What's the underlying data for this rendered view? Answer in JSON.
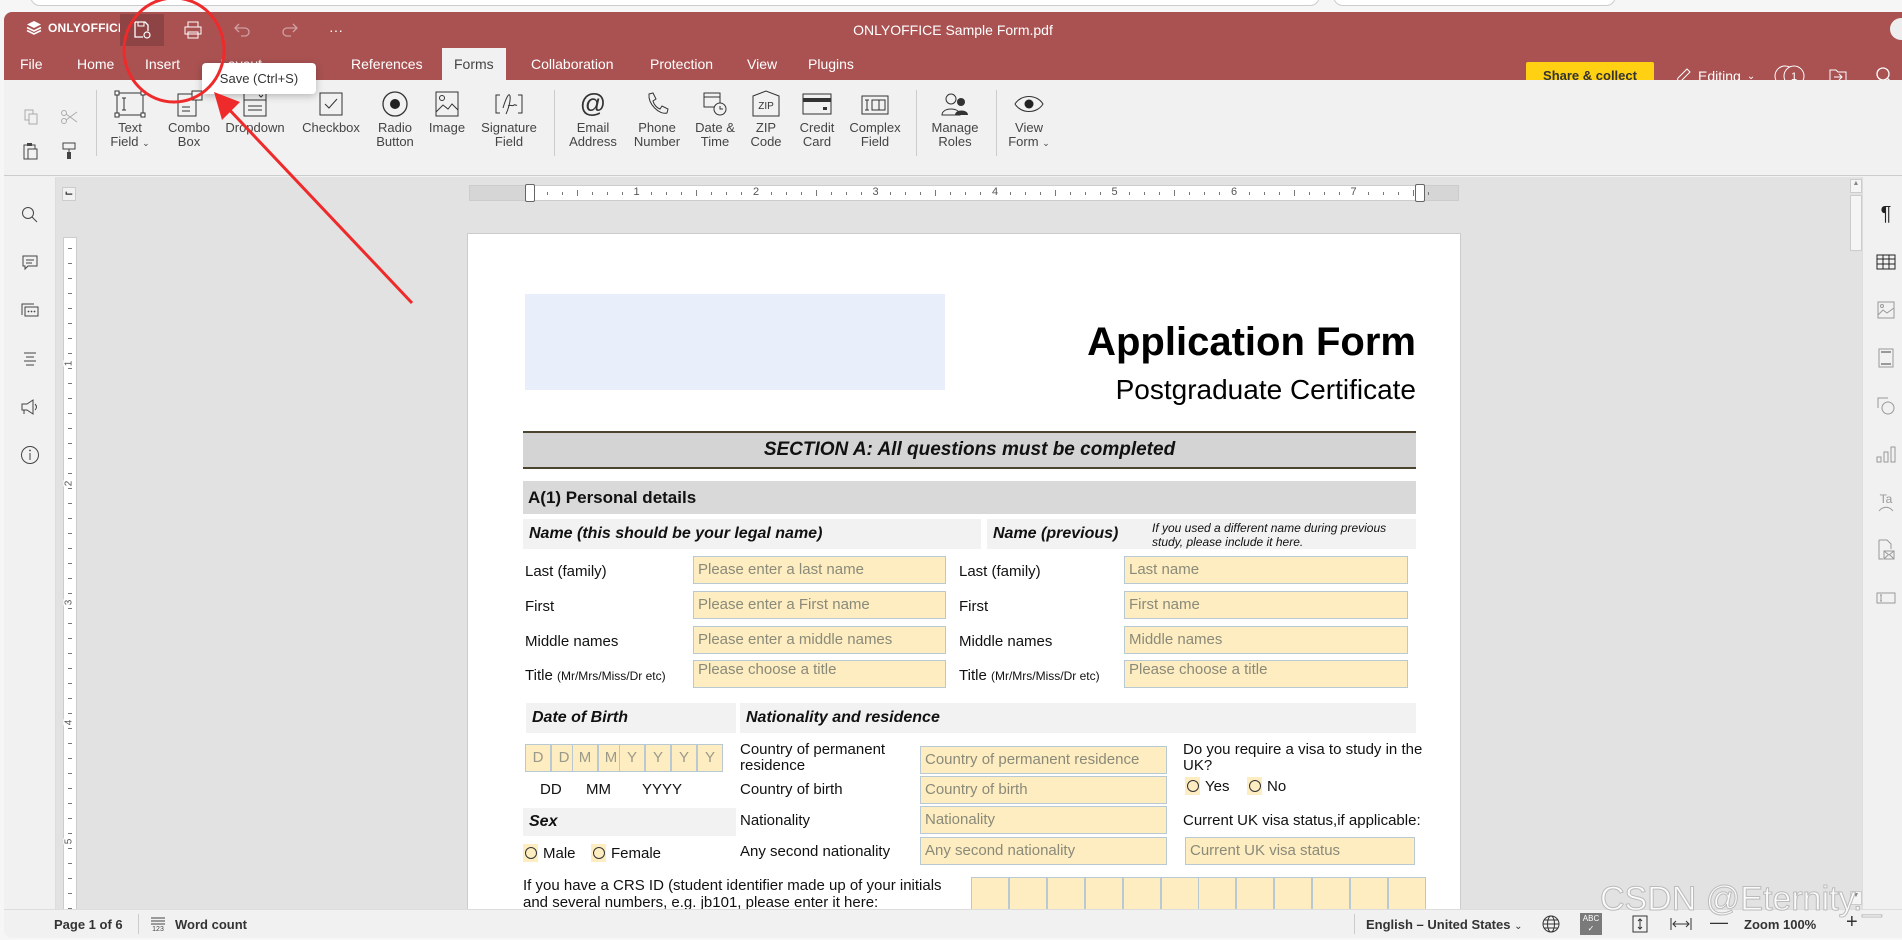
{
  "app": {
    "brand": "ONLYOFFICE",
    "document_title": "ONLYOFFICE Sample Form.pdf",
    "accent_color": "#aa5252",
    "quick_access": [
      {
        "name": "save",
        "icon": "save-icon",
        "tooltip": "Save (Ctrl+S)"
      },
      {
        "name": "print",
        "icon": "print-icon"
      },
      {
        "name": "undo",
        "icon": "undo-icon"
      },
      {
        "name": "redo",
        "icon": "redo-icon"
      },
      {
        "name": "more",
        "icon": "more-icon",
        "label": "···"
      }
    ]
  },
  "menu": {
    "tabs": [
      "File",
      "Home",
      "Insert",
      "Layout",
      "References",
      "Forms",
      "Collaboration",
      "Protection",
      "View",
      "Plugins"
    ],
    "active_tab": "Forms"
  },
  "header_right": {
    "share_label": "Share & collect",
    "share_color": "#ffd112",
    "mode_label": "Editing",
    "users_count": "1"
  },
  "tooltip": {
    "text": "Save (Ctrl+S)"
  },
  "toolbar": {
    "buttons": [
      {
        "label1": "Text",
        "label2": "Field",
        "dropdown": true
      },
      {
        "label1": "Combo",
        "label2": "Box"
      },
      {
        "label1": "Dropdown",
        "label2": ""
      },
      {
        "label1": "Checkbox",
        "label2": ""
      },
      {
        "label1": "Radio",
        "label2": "Button"
      },
      {
        "label1": "Image",
        "label2": ""
      },
      {
        "label1": "Signature",
        "label2": "Field"
      },
      {
        "label1": "Email",
        "label2": "Address"
      },
      {
        "label1": "Phone",
        "label2": "Number"
      },
      {
        "label1": "Date &",
        "label2": "Time"
      },
      {
        "label1": "ZIP",
        "label2": "Code"
      },
      {
        "label1": "Credit",
        "label2": "Card"
      },
      {
        "label1": "Complex",
        "label2": "Field"
      },
      {
        "label1": "Manage",
        "label2": "Roles"
      },
      {
        "label1": "View",
        "label2": "Form",
        "dropdown": true
      }
    ]
  },
  "ruler": {
    "marks": [
      "1",
      "2",
      "3",
      "4",
      "5",
      "6",
      "7"
    ],
    "vmarks": [
      "1",
      "2",
      "3",
      "4",
      "5"
    ]
  },
  "form": {
    "title": "Application Form",
    "subtitle": "Postgraduate Certificate",
    "section": "SECTION A: All questions must be completed",
    "subsection": "A(1) Personal details",
    "name_legal_head": "Name (this should be your legal name)",
    "name_prev_head": "Name (previous)",
    "name_prev_note": "If you used a different name during previous study, please include it here.",
    "legal_rows": [
      {
        "label": "Last (family)",
        "placeholder": "Please enter a last name"
      },
      {
        "label": "First",
        "placeholder": "Please enter a First name"
      },
      {
        "label": "Middle names",
        "placeholder": "Please enter a middle names"
      },
      {
        "label": "Title",
        "label_small": "(Mr/Mrs/Miss/Dr etc)",
        "placeholder": "Please choose a title"
      }
    ],
    "prev_rows": [
      {
        "label": "Last (family)",
        "placeholder": "Last name"
      },
      {
        "label": "First",
        "placeholder": "First name"
      },
      {
        "label": "Middle names",
        "placeholder": "Middle names"
      },
      {
        "label": "Title",
        "label_small": "(Mr/Mrs/Miss/Dr etc)",
        "placeholder": "Please choose a title"
      }
    ],
    "dob_head": "Date of Birth",
    "dob_cells": [
      "D",
      "D",
      "M",
      "M",
      "Y",
      "Y",
      "Y",
      "Y"
    ],
    "dob_hint": {
      "dd": "DD",
      "mm": "MM",
      "yyyy": "YYYY"
    },
    "sex_head": "Sex",
    "sex_options": [
      "Male",
      "Female"
    ],
    "nat_head": "Nationality and residence",
    "nat_rows": [
      {
        "label": "Country of permanent residence",
        "placeholder": "Country of permanent residence"
      },
      {
        "label": "Country of birth",
        "placeholder": "Country of birth"
      },
      {
        "label": "Nationality",
        "placeholder": "Nationality"
      },
      {
        "label": "Any second nationality",
        "placeholder": "Any second nationality"
      }
    ],
    "visa_question": "Do you require a visa to study in the UK?",
    "visa_options": [
      "Yes",
      "No"
    ],
    "visa_status_label": "Current UK visa status,if applicable:",
    "visa_status_placeholder": "Current UK visa status",
    "crs_label": "If you have a CRS ID (student identifier made up of your initials and several numbers, e.g. jb101, please enter it here:",
    "crs_cells": 12
  },
  "status": {
    "page": "Page 1 of 6",
    "word_count": "Word count",
    "language": "English – United States",
    "zoom": "Zoom 100%"
  },
  "watermark": "CSDN @Eternity._"
}
